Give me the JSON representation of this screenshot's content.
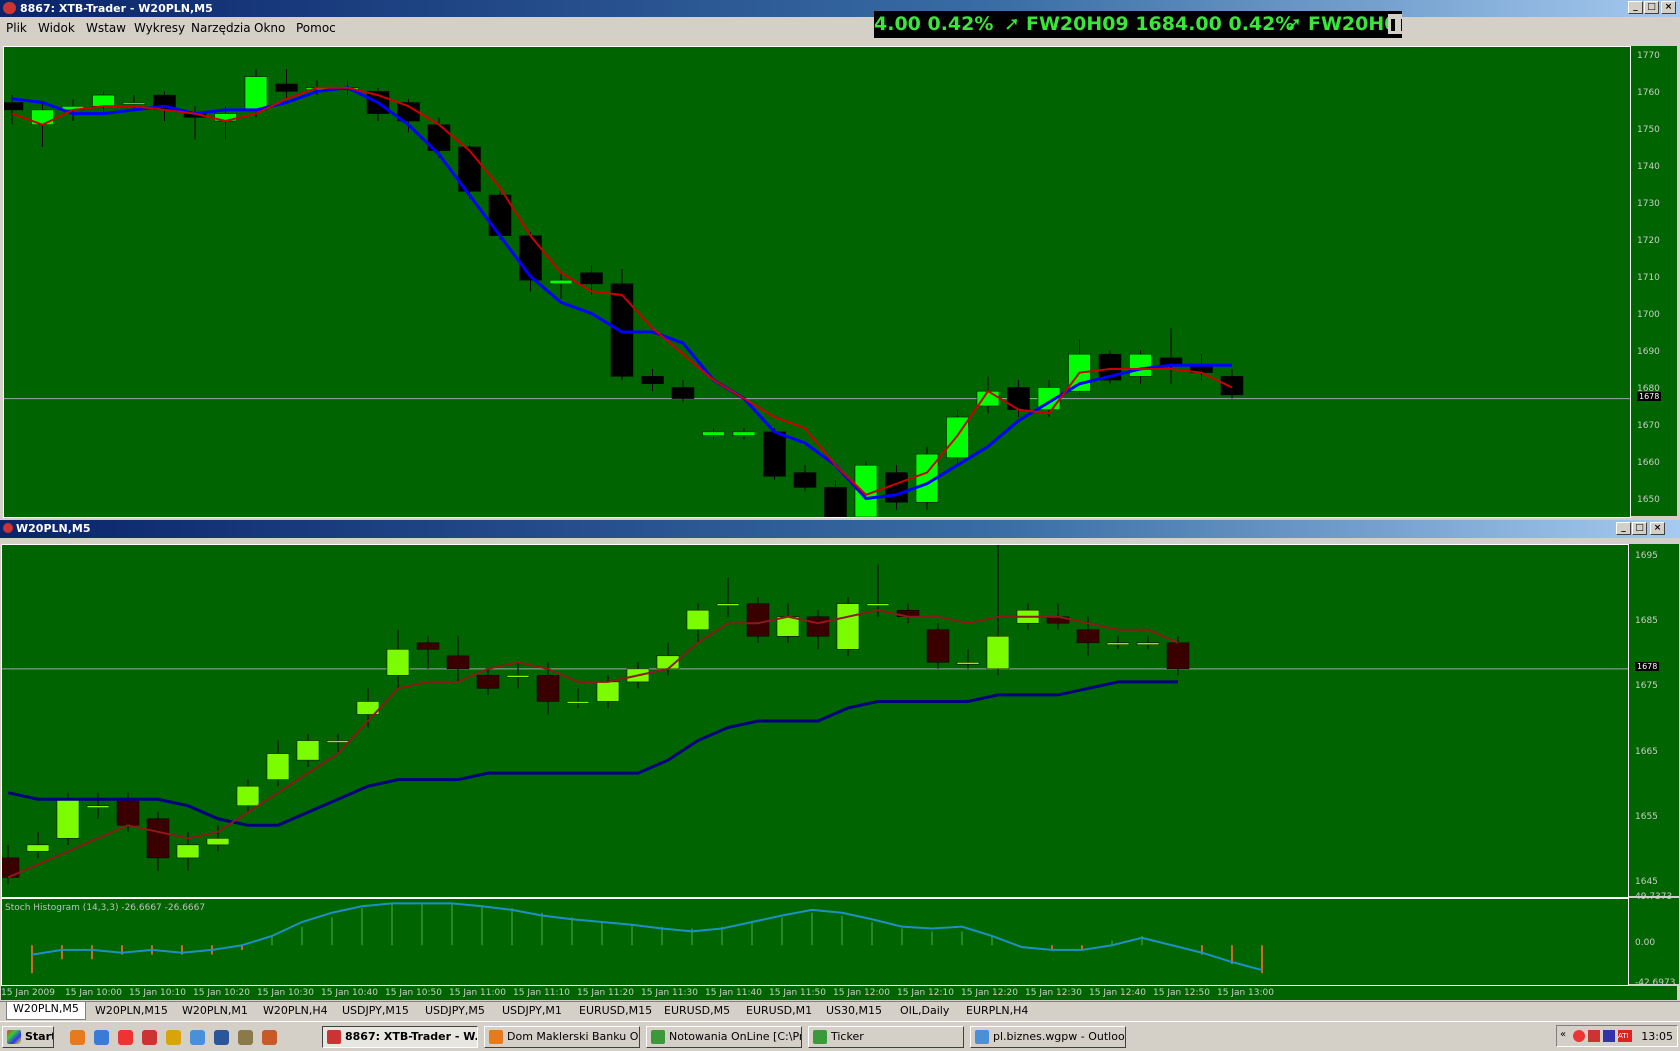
{
  "window": {
    "title": "8867: XTB-Trader - W20PLN,M5"
  },
  "menu": [
    "Plik",
    "Widok",
    "Wstaw",
    "Wykresy",
    "Narzędzia",
    "Okno",
    "Pomoc"
  ],
  "ticker": {
    "segments": [
      "4.00 0.42%",
      "FW20H09 1684.00 0.42%",
      "FW20H0"
    ]
  },
  "colors": {
    "chart_bg": "#006400",
    "bull_top": "#00ff00",
    "bull_bottom": "#7cfc00",
    "bear": "#000000",
    "bear_bottom": "#3a0000",
    "ma_fast": "#cc0000",
    "ma_slow_top": "#0000ff",
    "ma_slow_bottom": "#000080",
    "stoch": "#1e90c8"
  },
  "top_chart": {
    "price_axis": [
      "1770",
      "1760",
      "1750",
      "1740",
      "1730",
      "1720",
      "1710",
      "1700",
      "1690",
      "1680",
      "1670",
      "1660",
      "1650"
    ],
    "current_price": "1678"
  },
  "bottom_window": {
    "title": "W20PLN,M5",
    "price_axis": [
      "1695",
      "1685",
      "1675",
      "1665",
      "1655",
      "1645"
    ],
    "current_price": "1678",
    "stoch_label": "Stoch Histogram (14,3,3) -26.6667 -26.6667",
    "stoch_axis": [
      "49.7373",
      "0.00",
      "-42.6973"
    ],
    "time_axis": [
      "15 Jan 2009",
      "15 Jan 10:00",
      "15 Jan 10:10",
      "15 Jan 10:20",
      "15 Jan 10:30",
      "15 Jan 10:40",
      "15 Jan 10:50",
      "15 Jan 11:00",
      "15 Jan 11:10",
      "15 Jan 11:20",
      "15 Jan 11:30",
      "15 Jan 11:40",
      "15 Jan 11:50",
      "15 Jan 12:00",
      "15 Jan 12:10",
      "15 Jan 12:20",
      "15 Jan 12:30",
      "15 Jan 12:40",
      "15 Jan 12:50",
      "15 Jan 13:00"
    ]
  },
  "tabs": [
    "W20PLN,M5",
    "W20PLN,M15",
    "W20PLN,M1",
    "W20PLN,H4",
    "USDJPY,M15",
    "USDJPY,M5",
    "USDJPY,M1",
    "EURUSD,M15",
    "EURUSD,M5",
    "EURUSD,M1",
    "US30,M15",
    "OIL,Daily",
    "EURPLN,H4"
  ],
  "taskbar": {
    "start": "Start",
    "buttons": [
      "8867: XTB-Trader - W...",
      "Dom Maklerski Banku Oc...",
      "Notowania OnLine [C:\\Pr...",
      "Ticker",
      "pl.biznes.wgpw - Outloo..."
    ],
    "clock": "13:05"
  },
  "chart_data": [
    {
      "type": "candlestick",
      "title": "W20PLN,M5 (top)",
      "ylim": [
        1646,
        1773
      ],
      "candles": [
        [
          1758,
          1756,
          1760,
          1752
        ],
        [
          1752,
          1756,
          1758,
          1746
        ],
        [
          1756,
          1757,
          1759,
          1753
        ],
        [
          1757,
          1760,
          1761,
          1755
        ],
        [
          1758,
          1758,
          1760,
          1756
        ],
        [
          1760,
          1756,
          1761,
          1753
        ],
        [
          1755,
          1754,
          1757,
          1748
        ],
        [
          1753,
          1755,
          1757,
          1748
        ],
        [
          1756,
          1765,
          1767,
          1754
        ],
        [
          1763,
          1761,
          1767,
          1759
        ],
        [
          1762,
          1762,
          1764,
          1760
        ],
        [
          1762,
          1762,
          1764,
          1760
        ],
        [
          1761,
          1755,
          1762,
          1753
        ],
        [
          1758,
          1753,
          1759,
          1750
        ],
        [
          1752,
          1745,
          1754,
          1743
        ],
        [
          1746,
          1734,
          1747,
          1732
        ],
        [
          1733,
          1722,
          1734,
          1721
        ],
        [
          1722,
          1710,
          1723,
          1707
        ],
        [
          1709,
          1710,
          1712,
          1705
        ],
        [
          1712,
          1709,
          1714,
          1706
        ],
        [
          1709,
          1684,
          1713,
          1683
        ],
        [
          1684,
          1682,
          1686,
          1680
        ],
        [
          1681,
          1678,
          1683,
          1677
        ],
        [
          1668,
          1669,
          1670,
          1667
        ],
        [
          1668,
          1669,
          1670,
          1667
        ],
        [
          1669,
          1657,
          1670,
          1656
        ],
        [
          1658,
          1654,
          1660,
          1653
        ],
        [
          1654,
          1646,
          1656,
          1644
        ],
        [
          1646,
          1660,
          1661,
          1645
        ],
        [
          1658,
          1650,
          1660,
          1648
        ],
        [
          1650,
          1663,
          1665,
          1648
        ],
        [
          1662,
          1673,
          1675,
          1660
        ],
        [
          1676,
          1680,
          1684,
          1674
        ],
        [
          1681,
          1675,
          1683,
          1673
        ],
        [
          1675,
          1681,
          1683,
          1673
        ],
        [
          1680,
          1690,
          1694,
          1679
        ],
        [
          1690,
          1683,
          1691,
          1682
        ],
        [
          1684,
          1690,
          1691,
          1682
        ],
        [
          1689,
          1687,
          1697,
          1682
        ],
        [
          1687,
          1685,
          1690,
          1683
        ],
        [
          1684,
          1679,
          1686,
          1678
        ]
      ],
      "ma_fast": [
        1755,
        1752,
        1756,
        1757,
        1757,
        1756,
        1755,
        1753,
        1755,
        1759,
        1762,
        1762,
        1760,
        1757,
        1752,
        1745,
        1735,
        1722,
        1712,
        1707,
        1706,
        1697,
        1690,
        1683,
        1678,
        1673,
        1670,
        1660,
        1652,
        1655,
        1658,
        1668,
        1680,
        1675,
        1674,
        1685,
        1686,
        1686,
        1686,
        1685,
        1681
      ],
      "ma_slow": [
        1759,
        1758,
        1755,
        1755,
        1756,
        1757,
        1755,
        1756,
        1756,
        1758,
        1761,
        1762,
        1758,
        1752,
        1744,
        1733,
        1722,
        1711,
        1704,
        1701,
        1696,
        1696,
        1693,
        1683,
        1678,
        1669,
        1666,
        1660,
        1651,
        1652,
        1655,
        1660,
        1665,
        1672,
        1677,
        1682,
        1684,
        1686,
        1687,
        1687,
        1687
      ]
    },
    {
      "type": "candlestick",
      "title": "W20PLN,M5 (bottom)",
      "ylim": [
        1643,
        1697
      ],
      "candles": [
        [
          1649,
          1646,
          1651,
          1645
        ],
        [
          1650,
          1651,
          1653,
          1649
        ],
        [
          1652,
          1658,
          1659,
          1651
        ],
        [
          1657,
          1657,
          1659,
          1655
        ],
        [
          1658,
          1654,
          1659,
          1653
        ],
        [
          1655,
          1649,
          1656,
          1647
        ],
        [
          1649,
          1651,
          1653,
          1647
        ],
        [
          1651,
          1652,
          1654,
          1650
        ],
        [
          1657,
          1660,
          1661,
          1656
        ],
        [
          1661,
          1665,
          1667,
          1660
        ],
        [
          1664,
          1667,
          1668,
          1663
        ],
        [
          1667,
          1667,
          1668,
          1665
        ],
        [
          1671,
          1673,
          1675,
          1669
        ],
        [
          1677,
          1681,
          1684,
          1675
        ],
        [
          1682,
          1681,
          1683,
          1678
        ],
        [
          1680,
          1678,
          1683,
          1676
        ],
        [
          1677,
          1675,
          1678,
          1674
        ],
        [
          1677,
          1677,
          1679,
          1675
        ],
        [
          1677,
          1673,
          1679,
          1671
        ],
        [
          1673,
          1673,
          1675,
          1672
        ],
        [
          1673,
          1676,
          1677,
          1672
        ],
        [
          1676,
          1678,
          1679,
          1675
        ],
        [
          1678,
          1680,
          1682,
          1677
        ],
        [
          1684,
          1687,
          1688,
          1682
        ],
        [
          1688,
          1688,
          1692,
          1686
        ],
        [
          1688,
          1683,
          1689,
          1682
        ],
        [
          1683,
          1686,
          1688,
          1682
        ],
        [
          1686,
          1683,
          1687,
          1681
        ],
        [
          1681,
          1688,
          1689,
          1680
        ],
        [
          1688,
          1688,
          1694,
          1686
        ],
        [
          1687,
          1686,
          1688,
          1685
        ],
        [
          1684,
          1679,
          1685,
          1678
        ],
        [
          1679,
          1679,
          1681,
          1678
        ],
        [
          1678,
          1683,
          1698,
          1677
        ],
        [
          1685,
          1687,
          1688,
          1684
        ],
        [
          1686,
          1685,
          1688,
          1684
        ],
        [
          1684,
          1682,
          1686,
          1680
        ],
        [
          1682,
          1682,
          1683,
          1681
        ],
        [
          1682,
          1682,
          1683,
          1681
        ],
        [
          1682,
          1678,
          1683,
          1677
        ]
      ],
      "ma_fast": [
        1646,
        1648,
        1650,
        1652,
        1654,
        1653,
        1652,
        1653,
        1656,
        1659,
        1662,
        1665,
        1670,
        1675,
        1676,
        1676,
        1678,
        1679,
        1678,
        1676,
        1676,
        1677,
        1678,
        1682,
        1685,
        1685,
        1686,
        1685,
        1686,
        1687,
        1686,
        1686,
        1685,
        1686,
        1686,
        1686,
        1685,
        1684,
        1684,
        1682
      ],
      "ma_slow": [
        1659,
        1658,
        1658,
        1658,
        1658,
        1658,
        1657,
        1655,
        1654,
        1654,
        1656,
        1658,
        1660,
        1661,
        1661,
        1661,
        1662,
        1662,
        1662,
        1662,
        1662,
        1662,
        1664,
        1667,
        1669,
        1670,
        1670,
        1670,
        1672,
        1673,
        1673,
        1673,
        1673,
        1674,
        1674,
        1674,
        1675,
        1676,
        1676,
        1676
      ]
    },
    {
      "type": "histogram",
      "title": "Stoch Histogram (14,3,3)",
      "ylim": [
        -42.6973,
        49.7373
      ],
      "bars": [
        -30,
        -15,
        -15,
        -10,
        -10,
        -10,
        -10,
        -5,
        10,
        20,
        30,
        40,
        45,
        45,
        45,
        42,
        40,
        35,
        30,
        25,
        22,
        20,
        18,
        20,
        25,
        30,
        35,
        32,
        25,
        18,
        15,
        15,
        10,
        0,
        -5,
        -5,
        5,
        10,
        0,
        -10,
        -20,
        -30
      ],
      "line": [
        -10,
        -5,
        -5,
        -8,
        -5,
        -8,
        -5,
        0,
        10,
        25,
        35,
        42,
        45,
        45,
        45,
        42,
        38,
        32,
        28,
        25,
        22,
        18,
        15,
        18,
        25,
        32,
        38,
        35,
        28,
        20,
        18,
        20,
        10,
        -2,
        -5,
        -5,
        0,
        8,
        0,
        -8,
        -18,
        -26.6667
      ]
    }
  ]
}
